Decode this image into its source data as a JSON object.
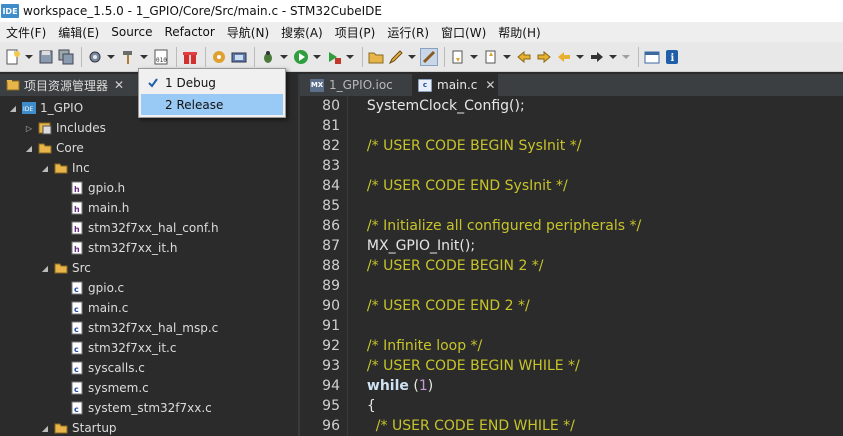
{
  "window": {
    "title": "workspace_1.5.0 - 1_GPIO/Core/Src/main.c - STM32CubeIDE",
    "app_icon_text": "IDE"
  },
  "menu": [
    "文件(F)",
    "编辑(E)",
    "Source",
    "Refactor",
    "导航(N)",
    "搜索(A)",
    "项目(P)",
    "运行(R)",
    "窗口(W)",
    "帮助(H)"
  ],
  "build_config_menu": {
    "items": [
      {
        "label": "1 Debug",
        "checked": true,
        "selected": false
      },
      {
        "label": "2 Release",
        "checked": false,
        "selected": true
      }
    ]
  },
  "explorer": {
    "tab_label": "项目资源管理器",
    "close_glyph": "✕",
    "tree": [
      {
        "label": "1_GPIO",
        "level": 0,
        "kind": "project",
        "expanded": true
      },
      {
        "label": "Includes",
        "level": 1,
        "kind": "includes",
        "expanded": false
      },
      {
        "label": "Core",
        "level": 1,
        "kind": "folder",
        "expanded": true
      },
      {
        "label": "Inc",
        "level": 2,
        "kind": "folder",
        "expanded": true
      },
      {
        "label": "gpio.h",
        "level": 3,
        "kind": "h"
      },
      {
        "label": "main.h",
        "level": 3,
        "kind": "h"
      },
      {
        "label": "stm32f7xx_hal_conf.h",
        "level": 3,
        "kind": "h"
      },
      {
        "label": "stm32f7xx_it.h",
        "level": 3,
        "kind": "h"
      },
      {
        "label": "Src",
        "level": 2,
        "kind": "folder",
        "expanded": true
      },
      {
        "label": "gpio.c",
        "level": 3,
        "kind": "c"
      },
      {
        "label": "main.c",
        "level": 3,
        "kind": "c"
      },
      {
        "label": "stm32f7xx_hal_msp.c",
        "level": 3,
        "kind": "c"
      },
      {
        "label": "stm32f7xx_it.c",
        "level": 3,
        "kind": "c"
      },
      {
        "label": "syscalls.c",
        "level": 3,
        "kind": "c"
      },
      {
        "label": "sysmem.c",
        "level": 3,
        "kind": "c"
      },
      {
        "label": "system_stm32f7xx.c",
        "level": 3,
        "kind": "c"
      },
      {
        "label": "Startup",
        "level": 2,
        "kind": "folder",
        "expanded": true
      }
    ]
  },
  "editor": {
    "tabs": [
      {
        "label": "1_GPIO.ioc",
        "icon_text": "MX",
        "active": false
      },
      {
        "label": "main.c",
        "icon_text": "c",
        "active": true,
        "close_glyph": "✕"
      }
    ],
    "lines": [
      {
        "no": "80",
        "segments": [
          {
            "t": "  SystemClock_Config();",
            "c": ""
          }
        ]
      },
      {
        "no": "81",
        "segments": [
          {
            "t": "",
            "c": ""
          }
        ]
      },
      {
        "no": "82",
        "segments": [
          {
            "t": "  /* USER CODE BEGIN SysInit */",
            "c": "cm"
          }
        ]
      },
      {
        "no": "83",
        "segments": [
          {
            "t": "",
            "c": ""
          }
        ]
      },
      {
        "no": "84",
        "segments": [
          {
            "t": "  /* USER CODE END SysInit */",
            "c": "cm"
          }
        ]
      },
      {
        "no": "85",
        "segments": [
          {
            "t": "",
            "c": ""
          }
        ]
      },
      {
        "no": "86",
        "segments": [
          {
            "t": "  /* Initialize all configured peripherals */",
            "c": "cm"
          }
        ]
      },
      {
        "no": "87",
        "segments": [
          {
            "t": "  MX_GPIO_Init();",
            "c": ""
          }
        ]
      },
      {
        "no": "88",
        "segments": [
          {
            "t": "  /* USER CODE BEGIN 2 */",
            "c": "cm"
          }
        ]
      },
      {
        "no": "89",
        "segments": [
          {
            "t": "",
            "c": ""
          }
        ]
      },
      {
        "no": "90",
        "segments": [
          {
            "t": "  /* USER CODE END 2 */",
            "c": "cm"
          }
        ]
      },
      {
        "no": "91",
        "segments": [
          {
            "t": "",
            "c": ""
          }
        ]
      },
      {
        "no": "92",
        "segments": [
          {
            "t": "  /* Infinite loop */",
            "c": "cm"
          }
        ]
      },
      {
        "no": "93",
        "segments": [
          {
            "t": "  /* USER CODE BEGIN WHILE */",
            "c": "cm"
          }
        ]
      },
      {
        "no": "94",
        "segments": [
          {
            "t": "  ",
            "c": ""
          },
          {
            "t": "while",
            "c": "kw"
          },
          {
            "t": " (",
            "c": ""
          },
          {
            "t": "1",
            "c": "num"
          },
          {
            "t": ")",
            "c": ""
          }
        ]
      },
      {
        "no": "95",
        "segments": [
          {
            "t": "  {",
            "c": ""
          }
        ]
      },
      {
        "no": "96",
        "segments": [
          {
            "t": "    /* USER CODE END WHILE */",
            "c": "cm"
          }
        ]
      }
    ]
  },
  "colors": {
    "comment": "#c7c42a",
    "keyword": "#cfe2f3",
    "number": "#c79bd8",
    "background": "#2b2b2b",
    "menu_highlight": "#99c9f5"
  }
}
